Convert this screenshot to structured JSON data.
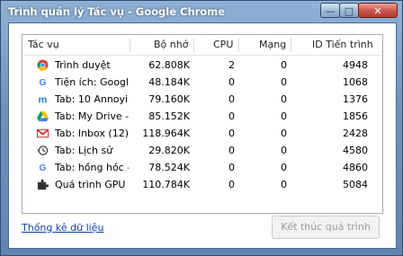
{
  "window": {
    "title": "Trình quản lý Tác vụ - Google Chrome"
  },
  "controls": {
    "minimize": "—",
    "maximize": "□",
    "close": "✕"
  },
  "columns": {
    "task": "Tác vụ",
    "memory": "Bộ nhớ",
    "cpu": "CPU",
    "network": "Mạng",
    "pid": "ID Tiến trình"
  },
  "rows": [
    {
      "icon": "chrome-icon",
      "name": "Trình duyệt",
      "memory": "62.808K",
      "cpu": "2",
      "network": "0",
      "pid": "4948"
    },
    {
      "icon": "google-icon",
      "name": "Tiện ích: Googl...",
      "memory": "48.184K",
      "cpu": "0",
      "network": "0",
      "pid": "1068"
    },
    {
      "icon": "annoying-m-icon",
      "name": "Tab: 10 Annoyi...",
      "memory": "79.160K",
      "cpu": "0",
      "network": "0",
      "pid": "1376"
    },
    {
      "icon": "google-drive-icon",
      "name": "Tab: My Drive -...",
      "memory": "85.152K",
      "cpu": "0",
      "network": "0",
      "pid": "1856"
    },
    {
      "icon": "gmail-icon",
      "name": "Tab: Inbox (12)...",
      "memory": "118.964K",
      "cpu": "0",
      "network": "0",
      "pid": "2428"
    },
    {
      "icon": "history-icon",
      "name": "Tab: Lịch sử",
      "memory": "29.820K",
      "cpu": "0",
      "network": "0",
      "pid": "4580"
    },
    {
      "icon": "google-icon",
      "name": "Tab: hồng hóc -...",
      "memory": "78.524K",
      "cpu": "0",
      "network": "0",
      "pid": "4860"
    },
    {
      "icon": "puzzle-icon",
      "name": "Quá trình GPU",
      "memory": "110.784K",
      "cpu": "0",
      "network": "0",
      "pid": "5084"
    }
  ],
  "footer": {
    "stats_link": "Thống kê dữ liệu",
    "end_process": "Kết thúc quá trình"
  },
  "colors": {
    "titlebar": "#6f95bd",
    "link": "#0b3fa3",
    "close_button": "#c9534a"
  }
}
